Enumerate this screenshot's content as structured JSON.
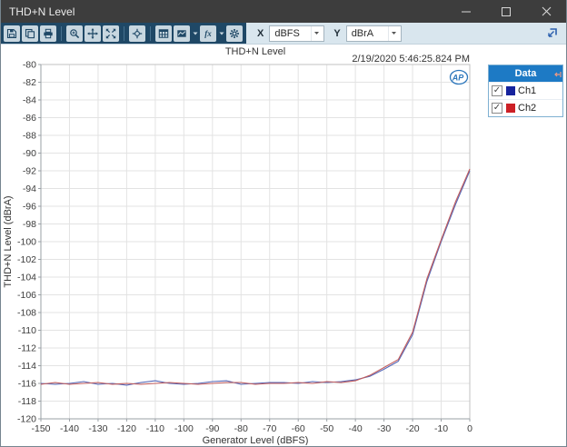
{
  "window": {
    "title": "THD+N Level",
    "controls": {
      "minimize": "–",
      "maximize": "□",
      "close": "×"
    }
  },
  "toolbar": {
    "items": [
      {
        "icon": "save-icon"
      },
      {
        "icon": "copy-icon"
      },
      {
        "icon": "print-icon"
      },
      {
        "separator": true
      },
      {
        "icon": "zoom-icon"
      },
      {
        "icon": "pan-icon"
      },
      {
        "icon": "fit-icon"
      },
      {
        "separator": true
      },
      {
        "icon": "crosshair-icon"
      },
      {
        "separator": true
      },
      {
        "icon": "table-icon"
      },
      {
        "icon": "chart-icon",
        "caret": true
      },
      {
        "icon": "fx-icon",
        "caret": true
      },
      {
        "icon": "settings-icon"
      }
    ],
    "x_label": "X",
    "x_unit_value": "dBFS",
    "y_label": "Y",
    "y_unit_value": "dBrA",
    "dock_icon": "dock-to-panel-icon"
  },
  "chart_header": {
    "title": "THD+N Level",
    "timestamp": "2/19/2020 5:46:25.824 PM"
  },
  "legend": {
    "header": "Data",
    "pin_icon": "pin-left-icon",
    "items": [
      {
        "label": "Ch1",
        "checked": true,
        "swatch_color": "#16239d"
      },
      {
        "label": "Ch2",
        "checked": true,
        "swatch_color": "#cc2026"
      }
    ]
  },
  "logo": {
    "text": "AP",
    "color": "#2e77bb"
  },
  "colors": {
    "titlebar_bg": "#3d3d3d",
    "toolbar_dark_bg": "#1f4866",
    "toolbar_light_bg": "#d9e6ee",
    "legend_header_bg": "#1d7ac5",
    "grid": "#e3e3e3",
    "plot_border": "#c2c2c2",
    "axis_line": "#9aa0a6",
    "tick_text": "#3c3c3c"
  },
  "chart_data": {
    "type": "line",
    "title": "THD+N Level",
    "xlabel": "Generator Level (dBFS)",
    "ylabel": "THD+N Level (dBrA)",
    "xlim": [
      -150,
      0
    ],
    "ylim": [
      -120,
      -80
    ],
    "x_tick_step": 10,
    "y_tick_step": 2,
    "grid": true,
    "legend_position": "top-right-floating",
    "x": [
      -150,
      -145,
      -140,
      -135,
      -130,
      -125,
      -120,
      -115,
      -110,
      -105,
      -100,
      -95,
      -90,
      -85,
      -80,
      -75,
      -70,
      -65,
      -60,
      -55,
      -50,
      -45,
      -40,
      -35,
      -30,
      -25,
      -20,
      -15,
      -10,
      -5,
      0
    ],
    "series": [
      {
        "name": "Ch1",
        "color": "#5568b8",
        "values": [
          -116.0,
          -116.1,
          -116.0,
          -115.8,
          -116.1,
          -116.0,
          -116.2,
          -115.9,
          -115.7,
          -116.0,
          -116.1,
          -116.0,
          -115.8,
          -115.7,
          -116.1,
          -116.0,
          -115.9,
          -115.9,
          -116.0,
          -115.8,
          -115.9,
          -115.8,
          -115.6,
          -115.2,
          -114.4,
          -113.5,
          -110.5,
          -104.5,
          -100.0,
          -95.8,
          -92.0
        ]
      },
      {
        "name": "Ch2",
        "color": "#c25c5c",
        "values": [
          -116.1,
          -115.9,
          -116.1,
          -116.0,
          -115.9,
          -116.1,
          -116.0,
          -116.1,
          -116.0,
          -115.9,
          -116.0,
          -116.1,
          -116.0,
          -115.9,
          -115.9,
          -116.1,
          -116.0,
          -116.0,
          -115.9,
          -116.0,
          -115.8,
          -115.9,
          -115.7,
          -115.1,
          -114.2,
          -113.3,
          -110.2,
          -104.2,
          -99.8,
          -95.5,
          -91.8
        ]
      }
    ]
  }
}
